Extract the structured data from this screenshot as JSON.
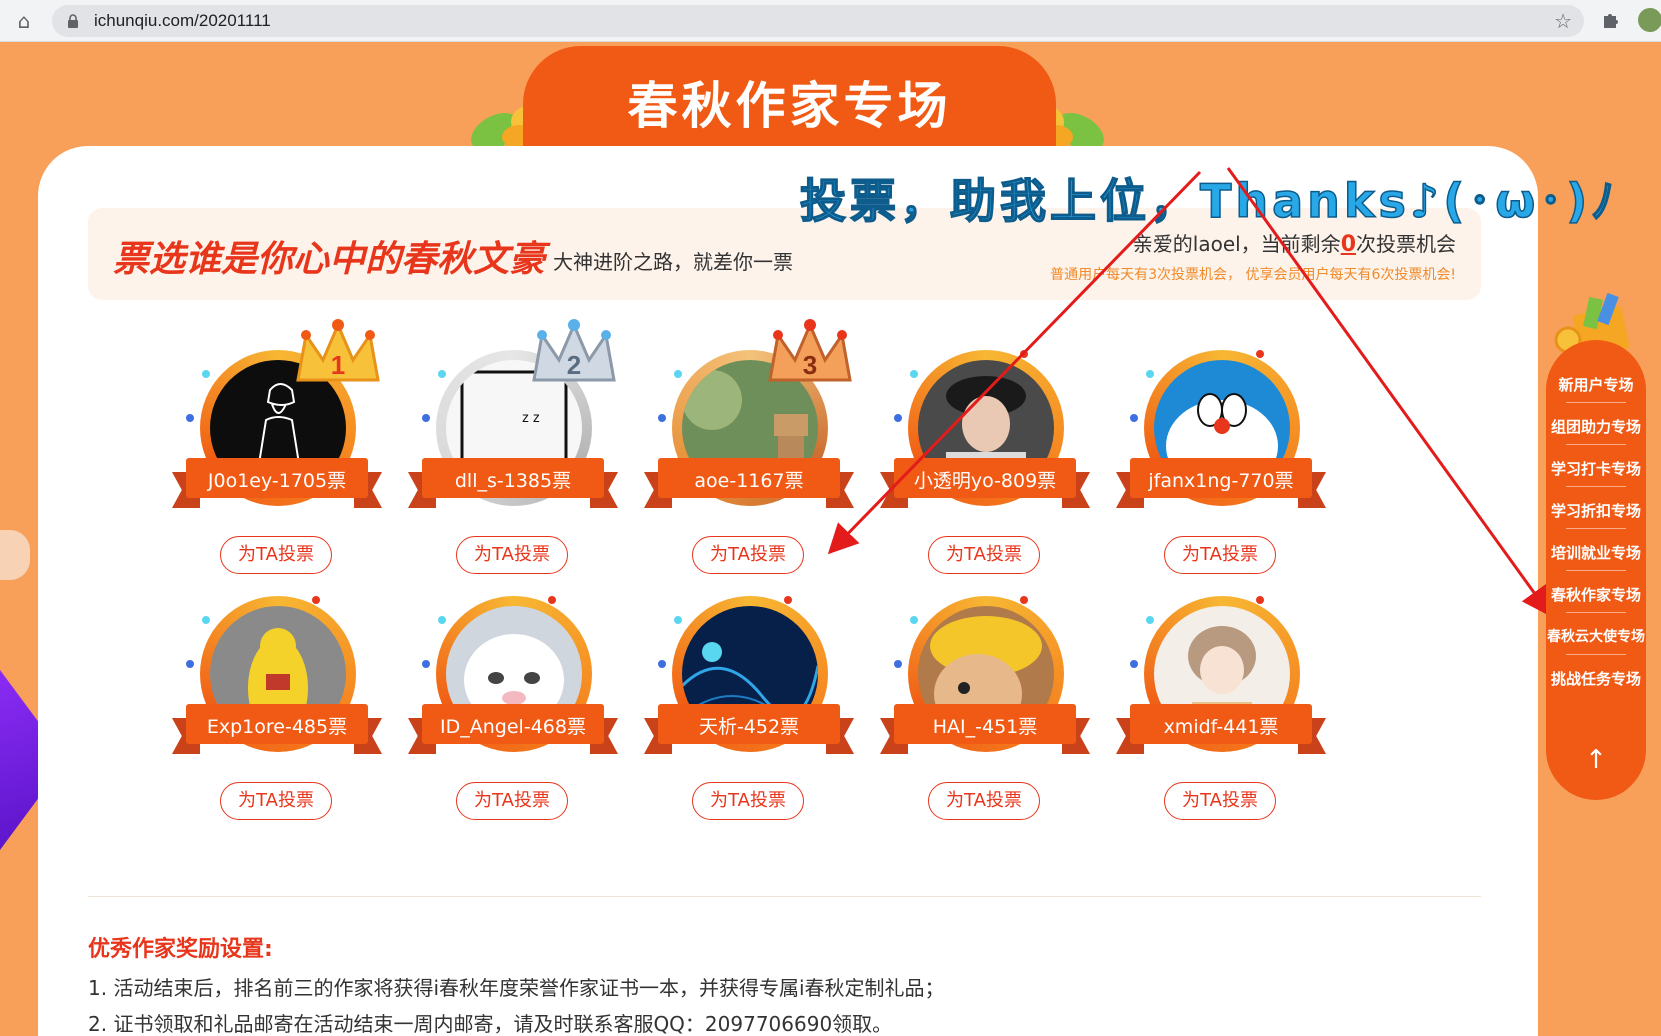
{
  "browser": {
    "url": "ichunqiu.com/20201111"
  },
  "banner": {
    "title": "春秋作家专场"
  },
  "annotation": {
    "text": "投票，助我上位，Thanks♪(･ω･)ﾉ"
  },
  "vote_panel": {
    "slogan": "票选谁是你心中的春秋文豪",
    "subtitle": "大神进阶之路，就差你一票",
    "remaining_prefix": "亲爱的laoel，当前剩余",
    "remaining_count": "0",
    "remaining_suffix": "次投票机会",
    "rule": "普通用户每天有3次投票机会， 优享会员用户每天有6次投票机会!"
  },
  "authors": [
    {
      "label": "J0o1ey-1705票",
      "rank_icon": "gold-crown-1-icon",
      "vote_button": "为TA投票"
    },
    {
      "label": "dll_s-1385票",
      "rank_icon": "silver-crown-2-icon",
      "vote_button": "为TA投票"
    },
    {
      "label": "aoe-1167票",
      "rank_icon": "bronze-crown-3-icon",
      "vote_button": "为TA投票"
    },
    {
      "label": "小透明yo-809票",
      "rank_icon": "",
      "vote_button": "为TA投票"
    },
    {
      "label": "jfanx1ng-770票",
      "rank_icon": "",
      "vote_button": "为TA投票"
    },
    {
      "label": "Exp1ore-485票",
      "rank_icon": "",
      "vote_button": "为TA投票"
    },
    {
      "label": "ID_Angel-468票",
      "rank_icon": "",
      "vote_button": "为TA投票"
    },
    {
      "label": "天析-452票",
      "rank_icon": "",
      "vote_button": "为TA投票"
    },
    {
      "label": "HAI_-451票",
      "rank_icon": "",
      "vote_button": "为TA投票"
    },
    {
      "label": "xmidf-441票",
      "rank_icon": "",
      "vote_button": "为TA投票"
    }
  ],
  "rewards": {
    "title": "优秀作家奖励设置:",
    "items": [
      "1. 活动结束后，排名前三的作家将获得i春秋年度荣誉作家证书一本，并获得专属i春秋定制礼品；",
      "2. 证书领取和礼品邮寄在活动结束一周内邮寄，请及时联系客服QQ：2097706690领取。"
    ]
  },
  "side_nav": {
    "items": [
      "新用户专场",
      "组团助力专场",
      "学习打卡专场",
      "学习折扣专场",
      "培训就业专场",
      "春秋作家专场",
      "春秋云大使专场",
      "挑战任务专场"
    ],
    "up_icon": "arrow-up-icon"
  },
  "colors": {
    "page_bg": "#f8a05a",
    "brand_orange": "#f05a14",
    "accent_red": "#e8361c",
    "annotation_blue": "#29a8e8",
    "arrow_red": "#e31b1b"
  }
}
